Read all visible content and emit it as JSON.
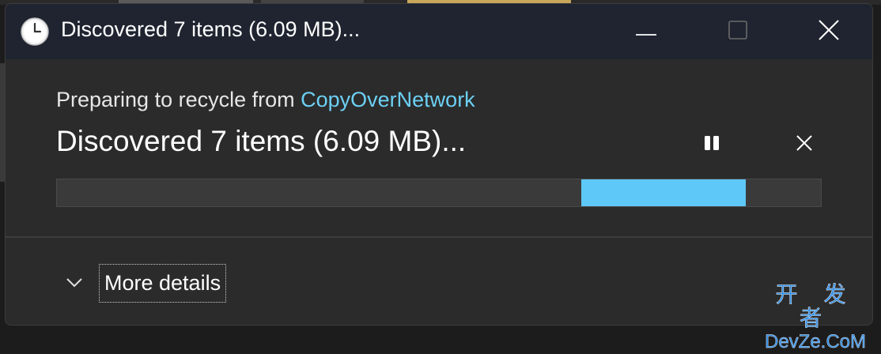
{
  "window": {
    "title": "Discovered 7 items (6.09 MB)...",
    "controls": {
      "minimize_icon": "minimize-icon",
      "maximize_icon": "maximize-icon",
      "close_icon": "close-icon"
    },
    "app_icon": "clock-icon"
  },
  "operation": {
    "subtitle_prefix": "Preparing to recycle from ",
    "subtitle_location": "CopyOverNetwork",
    "status_heading": "Discovered 7 items (6.09 MB)...",
    "pause_icon": "pause-icon",
    "cancel_icon": "close-icon",
    "progress": {
      "mode": "indeterminate",
      "indicator_start": 0.686,
      "indicator_width": 0.216
    }
  },
  "details": {
    "toggle_label": "More details",
    "chevron_icon": "chevron-down-icon"
  },
  "watermark": {
    "line1": "开 发 者",
    "line2": "DevZe.CoM"
  },
  "colors": {
    "titlebar_bg": "#1f2430",
    "dialog_bg": "#2b2b2b",
    "accent": "#5ec8f8",
    "link": "#6cd0f5",
    "watermark": "#2f8de4"
  }
}
